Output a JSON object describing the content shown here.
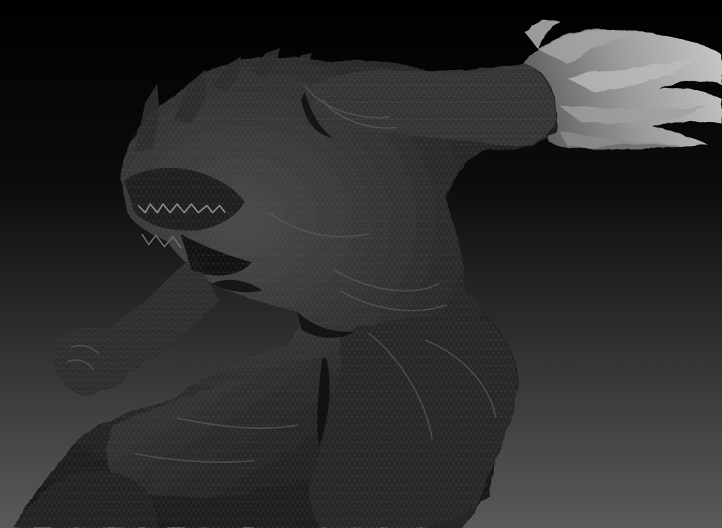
{
  "scene": {
    "subject": "creature-sculpt-render",
    "background_top_color": "#000000",
    "background_bottom_color": "#5a5a5a",
    "body_color": "#2b2b2b",
    "body_shadow_color": "#121212",
    "body_highlight_color": "#5c5c5c",
    "flame_color": "#8a8a8a",
    "flame_highlight_color": "#b8b8b8",
    "mesh_line_color": "#6a6a6a"
  }
}
